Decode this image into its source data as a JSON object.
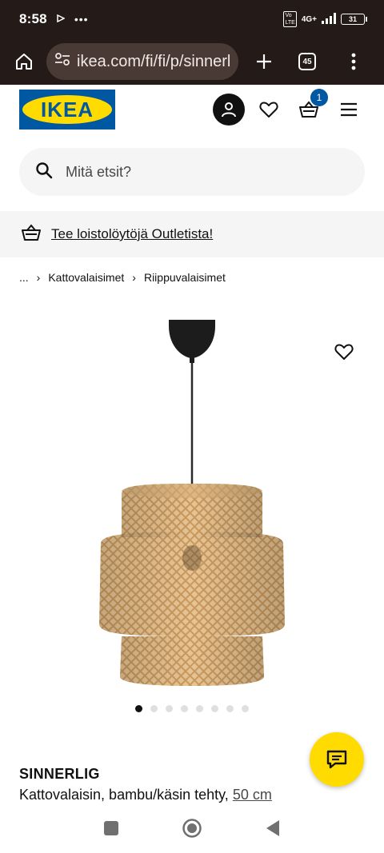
{
  "status_bar": {
    "time": "8:58",
    "network": "4G+",
    "battery": "31"
  },
  "browser": {
    "url": "ikea.com/fi/fi/p/sinnerlig",
    "tab_count": "45"
  },
  "header": {
    "logo_text": "IKEA",
    "cart_count": "1"
  },
  "search": {
    "placeholder": "Mitä etsit?"
  },
  "banner": {
    "text": "Tee loistolöytöjä Outletista!"
  },
  "breadcrumb": {
    "ellipsis": "...",
    "items": [
      "Kattovalaisimet",
      "Riippuvalaisimet"
    ]
  },
  "gallery": {
    "total_images": 8,
    "active_index": 0
  },
  "product": {
    "name": "SINNERLIG",
    "description": "Kattovalaisin, bambu/käsin tehty,",
    "size": "50 cm"
  },
  "colors": {
    "ikea_blue": "#0058a3",
    "ikea_yellow": "#ffdb00",
    "chrome_bar": "#241a18"
  }
}
